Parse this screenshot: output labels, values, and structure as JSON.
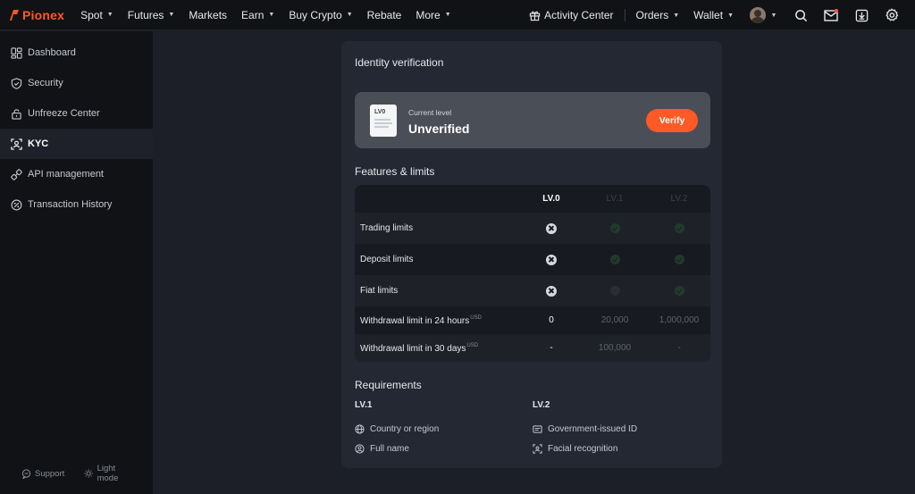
{
  "brand": {
    "name": "Pionex",
    "color": "#ff5a1f"
  },
  "nav": {
    "items": [
      {
        "label": "Spot",
        "caret": true
      },
      {
        "label": "Futures",
        "caret": true
      },
      {
        "label": "Markets",
        "caret": false
      },
      {
        "label": "Earn",
        "caret": true
      },
      {
        "label": "Buy Crypto",
        "caret": true
      },
      {
        "label": "Rebate",
        "caret": false
      },
      {
        "label": "More",
        "caret": true
      }
    ],
    "activity_center": "Activity Center",
    "orders": "Orders",
    "wallet": "Wallet",
    "icons": [
      "gift-icon",
      "avatar",
      "search-icon",
      "mail-icon",
      "download-icon",
      "settings-icon"
    ]
  },
  "sidebar": {
    "items": [
      {
        "label": "Dashboard",
        "icon": "dashboard-icon",
        "active": false
      },
      {
        "label": "Security",
        "icon": "shield-icon",
        "active": false
      },
      {
        "label": "Unfreeze Center",
        "icon": "lock-icon",
        "active": false
      },
      {
        "label": "KYC",
        "icon": "id-scan-icon",
        "active": true
      },
      {
        "label": "API management",
        "icon": "api-icon",
        "active": false
      },
      {
        "label": "Transaction History",
        "icon": "history-icon",
        "active": false
      }
    ],
    "support": "Support",
    "light_mode": "Light mode"
  },
  "kyc": {
    "title": "Identity verification",
    "doc_level": "LV0",
    "current_level_label": "Current level",
    "current_level_value": "Unverified",
    "verify_button": "Verify",
    "features_title": "Features & limits",
    "columns": [
      "LV.0",
      "LV.1",
      "LV.2"
    ],
    "rows": [
      {
        "label": "Trading limits",
        "unit": "",
        "values": [
          "x",
          "check",
          "check"
        ]
      },
      {
        "label": "Deposit limits",
        "unit": "",
        "values": [
          "x",
          "check",
          "check"
        ]
      },
      {
        "label": "Fiat limits",
        "unit": "",
        "values": [
          "x",
          "disabled",
          "check"
        ]
      },
      {
        "label": "Withdrawal limit in 24 hours",
        "unit": "USD",
        "values": [
          "0",
          "20,000",
          "1,000,000"
        ]
      },
      {
        "label": "Withdrawal limit in 30 days",
        "unit": "USD",
        "values": [
          "-",
          "100,000",
          "-"
        ]
      }
    ],
    "requirements_title": "Requirements",
    "requirements": [
      {
        "level": "LV.1",
        "items": [
          {
            "label": "Country or region",
            "icon": "globe-icon"
          },
          {
            "label": "Full name",
            "icon": "user-icon"
          }
        ]
      },
      {
        "level": "LV.2",
        "items": [
          {
            "label": "Government-issued ID",
            "icon": "id-card-icon"
          },
          {
            "label": "Facial recognition",
            "icon": "face-scan-icon"
          }
        ]
      }
    ],
    "accent": "#ff5a26"
  }
}
